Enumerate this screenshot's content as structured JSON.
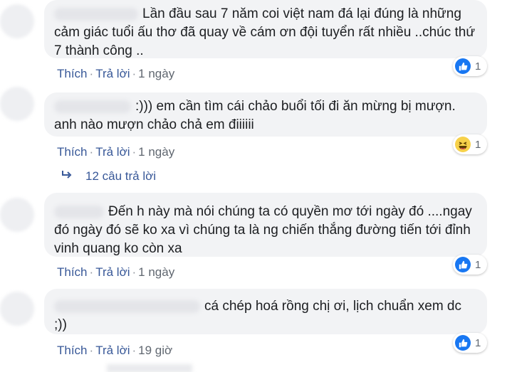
{
  "comments": [
    {
      "text": "Lần đầu sau 7 năm coi việt nam đá lại đúng là những cảm giác tuổi ấu thơ đã quay về cám ơn đội tuyển rất nhiều ..chúc thứ 7 thành công ..",
      "actions": {
        "like": "Thích",
        "reply": "Trả lời",
        "time": "1 ngày"
      },
      "reaction": {
        "icon": "like-icon",
        "count": "1"
      }
    },
    {
      "text": ":))) em cần tìm cái chảo buổi tối đi ăn mừng bị mượn. anh nào mượn chảo chả em điiiiii",
      "actions": {
        "like": "Thích",
        "reply": "Trả lời",
        "time": "1 ngày"
      },
      "reaction": {
        "icon": "haha-icon",
        "count": "1"
      }
    },
    {
      "text": "Đến h này mà nói chúng ta có quyền mơ tới ngày đó ....ngay đó ngày đó sẽ ko xa vì chúng ta là ng chiến thắng đường tiến tới đỉnh vinh quang ko còn xa",
      "actions": {
        "like": "Thích",
        "reply": "Trả lời",
        "time": "1 ngày"
      },
      "reaction": {
        "icon": "like-icon",
        "count": "1"
      }
    },
    {
      "text": "cá chép hoá rồng chị ơi, lịch chuẩn xem dc ;))",
      "actions": {
        "like": "Thích",
        "reply": "Trả lời",
        "time": "19 giờ"
      },
      "reaction": {
        "icon": "like-icon",
        "count": "1"
      }
    }
  ],
  "replies_link": {
    "icon": "reply-arrow-icon",
    "label": "12 câu trả lời"
  },
  "separator": "·",
  "colors": {
    "bubble": "#f2f3f5",
    "link": "#385898",
    "like_blue": "#1877f2",
    "haha_yellow": "#f7d14a"
  }
}
